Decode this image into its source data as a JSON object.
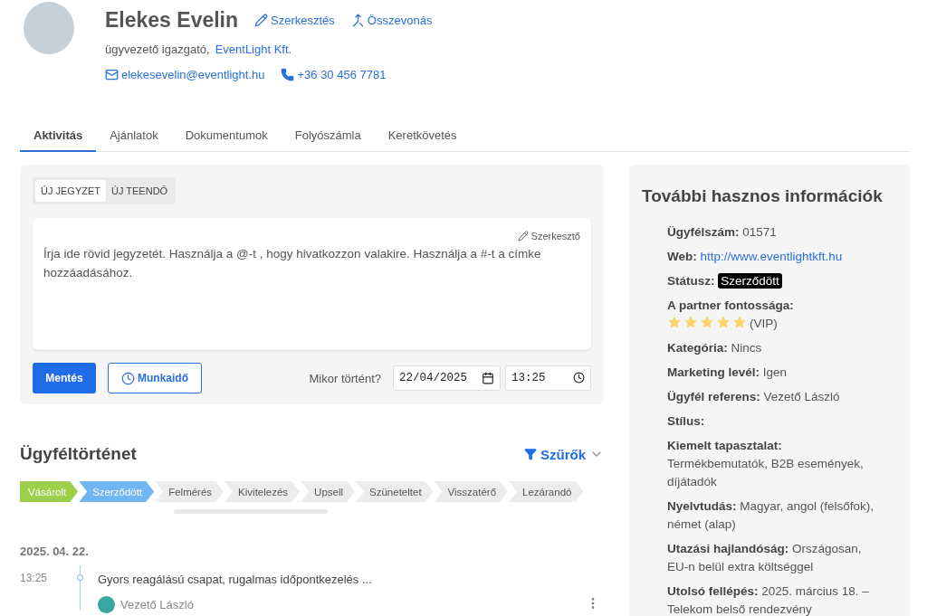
{
  "contact": {
    "name": "Elekes Evelin",
    "actions": [
      {
        "kind": "edit",
        "label": "Szerkesztés"
      },
      {
        "kind": "merge",
        "label": "Összevonás"
      }
    ],
    "role": "ügyvezető igazgató,",
    "company": "EventLight Kft.",
    "email": "elekesevelin@eventlight.hu",
    "phone": "+36 30 456 7781"
  },
  "tabs": [
    {
      "label": "Aktivitás",
      "selected": true
    },
    {
      "label": "Ajánlatok",
      "selected": false
    },
    {
      "label": "Dokumentumok",
      "selected": false
    },
    {
      "label": "Folyószámla",
      "selected": false
    },
    {
      "label": "Keretkövetés",
      "selected": false
    }
  ],
  "note": {
    "types": [
      {
        "label": "ÚJ JEGYZET",
        "selected": true
      },
      {
        "label": "ÚJ TEENDŐ",
        "selected": false
      }
    ],
    "editor_link": "Szerkesztő",
    "placeholder": "Írja ide rövid jegyzetét. Használja a @-t , hogy hivatkozzon valakire. Használja a #-t a címke hozzáadásához.",
    "save": "Mentés",
    "worktime": "Munkaidő",
    "when_label": "Mikor történt?",
    "date": "22/04/2025",
    "time": "13:25"
  },
  "history": {
    "title": "Ügyféltörténet",
    "filter": "Szűrők",
    "stages": [
      {
        "label": "Vásárolt",
        "color": "#9dd04a"
      },
      {
        "label": "Szerződött",
        "color": "#70b6f4"
      },
      {
        "label": "Felmérés",
        "color": "#ececec"
      },
      {
        "label": "Kivitelezés",
        "color": "#ececec"
      },
      {
        "label": "Upsell",
        "color": "#ececec"
      },
      {
        "label": "Szüneteltet",
        "color": "#ececec"
      },
      {
        "label": "Visszatérő",
        "color": "#ececec"
      },
      {
        "label": "Lezárandó",
        "color": "#ececec"
      }
    ],
    "days": [
      {
        "date": "2025. 04. 22.",
        "entries": [
          {
            "time": "13:25",
            "text": "Gyors reagálású csapat, rugalmas időpontkezelés ...",
            "author": "Vezető László"
          }
        ]
      }
    ]
  },
  "info": {
    "title": "További hasznos információk",
    "items": [
      {
        "kind": "text",
        "label": "Ügyfélszám:",
        "value": "01571"
      },
      {
        "kind": "link",
        "label": "Web:",
        "value": "http://www.eventlightkft.hu"
      },
      {
        "kind": "badge",
        "label": "Státusz:",
        "value": "Szerződött"
      },
      {
        "kind": "stars",
        "label": "A partner fontossága:",
        "stars": 5,
        "value": "(VIP)"
      },
      {
        "kind": "text",
        "label": "Kategória:",
        "value": "Nincs"
      },
      {
        "kind": "text",
        "label": "Marketing levél:",
        "value": "Igen"
      },
      {
        "kind": "text",
        "label": "Ügyfél referens:",
        "value": "Vezető László"
      },
      {
        "kind": "text",
        "label": "Stílus:"
      },
      {
        "kind": "text",
        "label": "Kiemelt tapasztalat:",
        "value": "Termékbemutatók, B2B események, díjátadók"
      },
      {
        "kind": "text",
        "label": "Nyelvtudás:",
        "value": "Magyar, angol (felsőfok), német (alap)"
      },
      {
        "kind": "text",
        "label": "Utazási hajlandóság:",
        "value": "Országosan, EU-n belül extra költséggel"
      },
      {
        "kind": "text",
        "label": "Utolsó fellépés:",
        "value": "2025. március 18. – Telekom belső rendezvény"
      }
    ]
  }
}
